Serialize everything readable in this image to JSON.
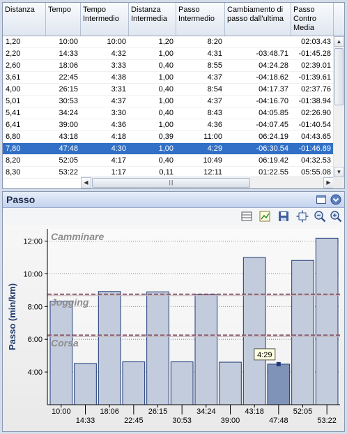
{
  "table": {
    "headers": [
      "Distanza",
      "Tempo",
      "Tempo Intermedio",
      "Distanza Intermedia",
      "Passo Intermedio",
      "Cambiamento di passo dall'ultima",
      "Passo Contro Media"
    ],
    "rows": [
      [
        "1,20",
        "10:00",
        "10:00",
        "1,20",
        "8:20",
        "",
        "02:03.43"
      ],
      [
        "2,20",
        "14:33",
        "4:32",
        "1,00",
        "4:31",
        "-03:48.71",
        "-01:45.28"
      ],
      [
        "2,60",
        "18:06",
        "3:33",
        "0,40",
        "8:55",
        "04:24.28",
        "02:39.01"
      ],
      [
        "3,61",
        "22:45",
        "4:38",
        "1,00",
        "4:37",
        "-04:18.62",
        "-01:39.61"
      ],
      [
        "4,00",
        "26:15",
        "3:31",
        "0,40",
        "8:54",
        "04:17.37",
        "02:37.76"
      ],
      [
        "5,01",
        "30:53",
        "4:37",
        "1,00",
        "4:37",
        "-04:16.70",
        "-01:38.94"
      ],
      [
        "5,41",
        "34:24",
        "3:30",
        "0,40",
        "8:43",
        "04:05.85",
        "02:26.90"
      ],
      [
        "6,41",
        "39:00",
        "4:36",
        "1,00",
        "4:36",
        "-04:07.45",
        "-01:40.54"
      ],
      [
        "6,80",
        "43:18",
        "4:18",
        "0,39",
        "11:00",
        "06:24.19",
        "04:43.65"
      ],
      [
        "7,80",
        "47:48",
        "4:30",
        "1,00",
        "4:29",
        "-06:30.54",
        "-01:46.89"
      ],
      [
        "8,20",
        "52:05",
        "4:17",
        "0,40",
        "10:49",
        "06:19.42",
        "04:32.53"
      ],
      [
        "8,30",
        "53:22",
        "1:17",
        "0,11",
        "12:11",
        "01:22.55",
        "05:55.08"
      ]
    ],
    "selected_row": 9
  },
  "chart_panel": {
    "title": "Passo"
  },
  "chart_data": {
    "type": "bar",
    "ylabel": "Passo (min/km)",
    "ylim_minutes": [
      2.0,
      12.75
    ],
    "y_ticks": [
      "4:00",
      "6:00",
      "8:00",
      "10:00",
      "12:00"
    ],
    "y_tick_values": [
      4,
      6,
      8,
      10,
      12
    ],
    "categories": [
      "10:00",
      "14:33",
      "18:06",
      "22:45",
      "26:15",
      "30:53",
      "34:24",
      "39:00",
      "43:18",
      "47:48",
      "52:05",
      "53:22"
    ],
    "values_minutes": [
      8.33,
      4.52,
      8.92,
      4.62,
      8.9,
      4.62,
      8.72,
      4.6,
      11.0,
      4.48,
      10.82,
      12.18
    ],
    "highlighted_index": 9,
    "tooltip": "4:29",
    "zones": [
      {
        "name": "Camminare",
        "value": 12.75
      },
      {
        "name": "Jogging",
        "value": 8.75
      },
      {
        "name": "Corsa",
        "value": 6.25
      }
    ],
    "colors": {
      "bar": "#c3ccdc",
      "bar_selected": "#7f93b8",
      "bar_border": "#1e3a78",
      "zone_line": "#8a5a6c",
      "zone_label": "#8e8e8e"
    }
  }
}
